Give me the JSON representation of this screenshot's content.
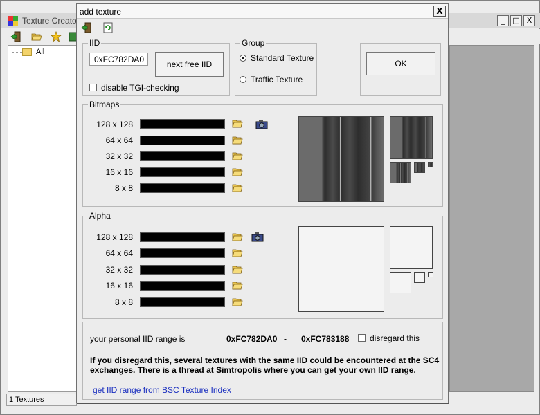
{
  "background_window": {
    "title": "Texture Creator",
    "controls": [
      "_",
      "□",
      "X"
    ],
    "tree_root": "All",
    "status": "1 Textures"
  },
  "dialog": {
    "title": "add texture",
    "close_glyph": "X",
    "iid": {
      "legend": "IID",
      "value": "0xFC782DA0",
      "next_button": "next free IID",
      "disable_tgi_label": "disable TGI-checking",
      "disable_tgi_checked": false
    },
    "group": {
      "legend": "Group",
      "options": [
        {
          "label": "Standard Texture",
          "selected": true
        },
        {
          "label": "Traffic Texture",
          "selected": false
        }
      ]
    },
    "ok_button": "OK",
    "bitmaps": {
      "legend": "Bitmaps",
      "sizes": [
        "128 x 128",
        "64 x 64",
        "32 x 32",
        "16 x 16",
        "8 x 8"
      ]
    },
    "alpha": {
      "legend": "Alpha",
      "sizes": [
        "128 x 128",
        "64 x 64",
        "32 x 32",
        "16 x 16",
        "8 x 8"
      ]
    },
    "range": {
      "intro": "your personal IID range is",
      "start": "0xFC782DA0",
      "separator": "-",
      "end": "0xFC783188",
      "disregard_label": "disregard this",
      "disregard_checked": false,
      "warning_line1": "If you disregard this, several textures with the same IID could be encountered at the SC4",
      "warning_line2": "exchanges. There is a thread at Simtropolis where you can get your own IID range.",
      "link": "get IID range from BSC Texture Index"
    }
  },
  "colors": {
    "dialog_bg": "#ececec",
    "link": "#1a2fbf",
    "filename_bar": "#000000"
  },
  "icons": [
    "exit-icon",
    "refresh-icon",
    "open-folder-icon",
    "favorite-star-icon",
    "camera-icon"
  ]
}
